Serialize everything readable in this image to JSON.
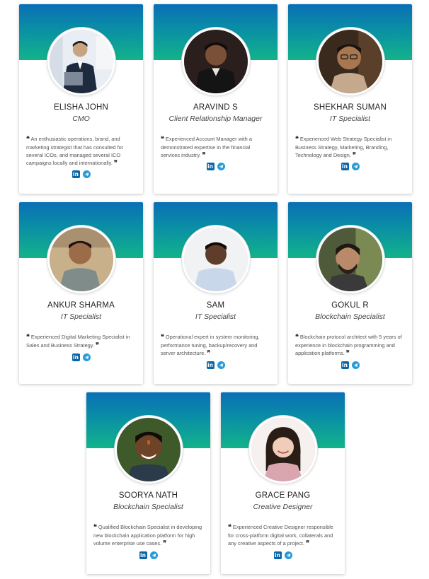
{
  "team": [
    {
      "name": "ELISHA JOHN",
      "role": "CMO",
      "bio": "An enthusiastic operations, brand, and marketing strategist that has consulted for several ICOs, and managed several ICO campaigns locally and internationally.",
      "linkedin_icon": "linkedin-icon",
      "telegram_icon": "telegram-icon"
    },
    {
      "name": "ARAVIND S",
      "role": "Client Relationship Manager",
      "bio": "Experienced Account Manager with a demonstrated expertise in the financial services industry.",
      "linkedin_icon": "linkedin-icon",
      "telegram_icon": "telegram-icon"
    },
    {
      "name": "SHEKHAR SUMAN",
      "role": "IT Specialist",
      "bio": "Experienced Web Strategy Specialist in Business Strategy, Marketing, Branding, Technology and Design.",
      "linkedin_icon": "linkedin-icon",
      "telegram_icon": "telegram-icon"
    },
    {
      "name": "ANKUR SHARMA",
      "role": "IT Specialist",
      "bio": "Experienced Digital Marketing Specialist in Sales and Business Strategy.",
      "linkedin_icon": "linkedin-icon",
      "telegram_icon": "telegram-icon"
    },
    {
      "name": "SAM",
      "role": "IT Specialist",
      "bio": "Operational expert in system monitoring, performance tuning, backup/recovery and server architecture.",
      "linkedin_icon": "linkedin-icon",
      "telegram_icon": "telegram-icon"
    },
    {
      "name": "GOKUL R",
      "role": "Blockchain Specialist",
      "bio": "Blockchain protocol architect with 5 years of experience in blockchain programming and application platforms.",
      "linkedin_icon": "linkedin-icon",
      "telegram_icon": "telegram-icon"
    },
    {
      "name": "SOORYA NATH",
      "role": "Blockchain Specialist",
      "bio": "Qualified Blockchain Specialist in developing new blockchain application platform for high volume enterprise use cases.",
      "linkedin_icon": "linkedin-icon",
      "telegram_icon": "telegram-icon"
    },
    {
      "name": "GRACE PANG",
      "role": "Creative Designer",
      "bio": "Experienced Creative Designer responsible for cross-platform digital work, collaterals and any creative aspects of a project.",
      "linkedin_icon": "linkedin-icon",
      "telegram_icon": "telegram-icon"
    }
  ],
  "colors": {
    "header_top": "#0a6fb6",
    "header_bottom": "#12b38a",
    "linkedin": "#0a66a8",
    "telegram": "#2a9ad6"
  }
}
